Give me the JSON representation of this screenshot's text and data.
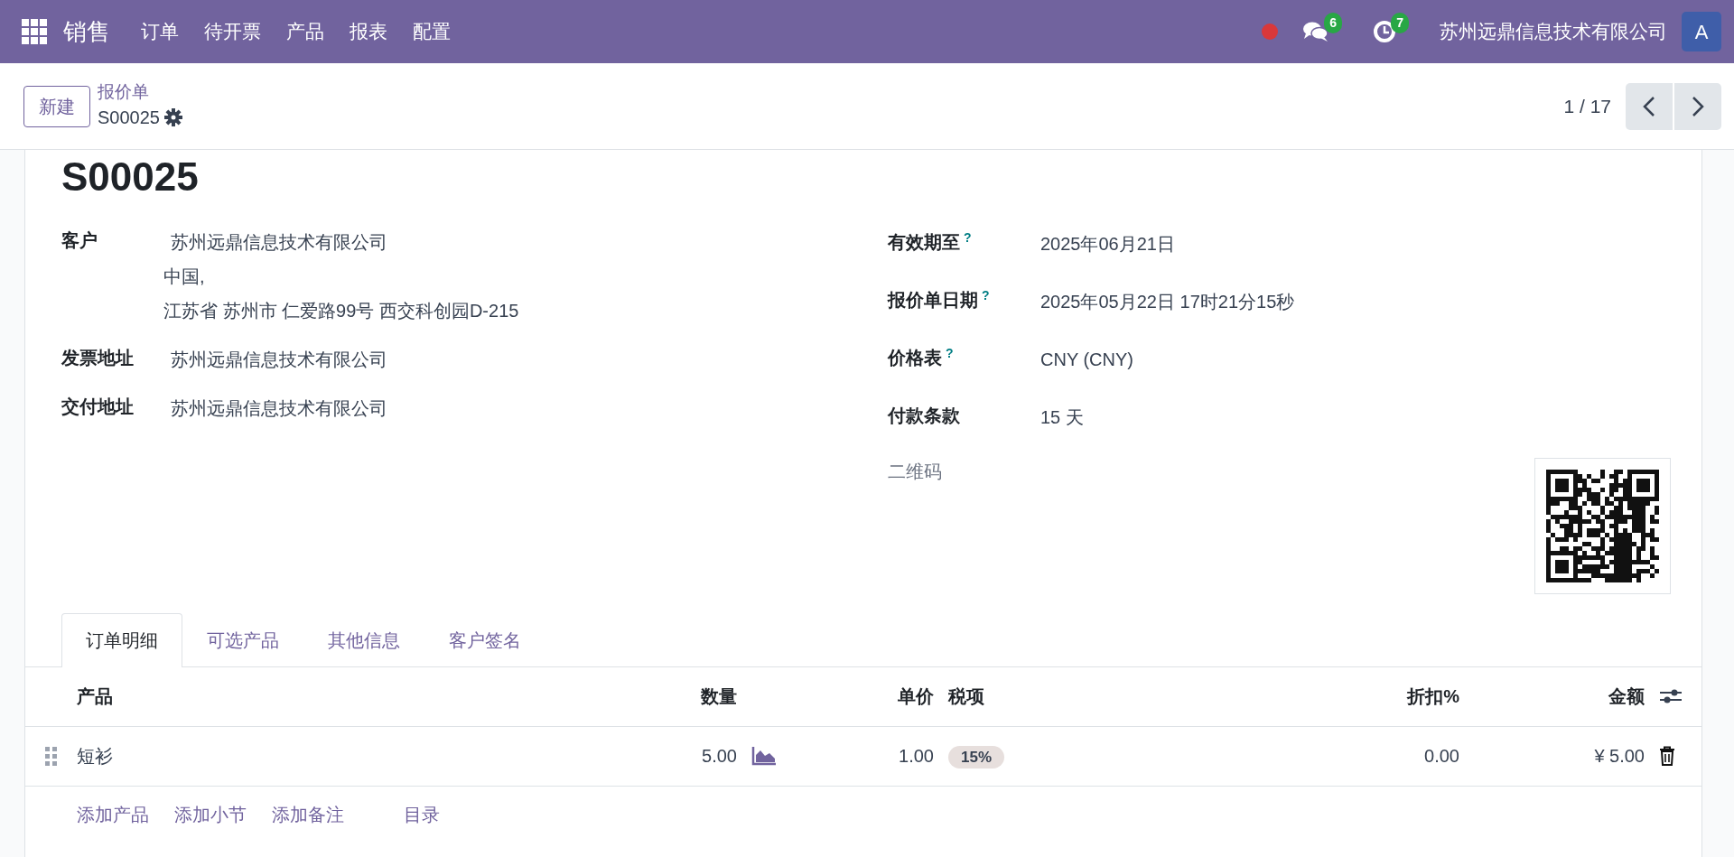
{
  "navbar": {
    "app_name": "销售",
    "menu": [
      "订单",
      "待开票",
      "产品",
      "报表",
      "配置"
    ],
    "chat_count": "6",
    "activity_count": "7",
    "company": "苏州远鼎信息技术有限公司",
    "avatar": "A"
  },
  "control_panel": {
    "new_button": "新建",
    "breadcrumb": "报价单",
    "record": "S00025",
    "pager": "1 / 17"
  },
  "form": {
    "title": "S00025",
    "left_fields": [
      {
        "label": "客户",
        "value": "苏州远鼎信息技术有限公司",
        "address_lines": [
          "中国,",
          "江苏省 苏州市 仁爱路99号 西交科创园D-215"
        ]
      },
      {
        "label": "发票地址",
        "value": "苏州远鼎信息技术有限公司"
      },
      {
        "label": "交付地址",
        "value": "苏州远鼎信息技术有限公司"
      }
    ],
    "right_fields": [
      {
        "label": "有效期至",
        "hint": "?",
        "value": "2025年06月21日"
      },
      {
        "label": "报价单日期",
        "hint": "?",
        "value": "2025年05月22日 17时21分15秒"
      },
      {
        "label": "价格表",
        "hint": "?",
        "value": "CNY (CNY)"
      },
      {
        "label": "付款条款",
        "value": "15 天"
      }
    ],
    "qr_label": "二维码"
  },
  "tabs": [
    {
      "label": "订单明细",
      "selected": true
    },
    {
      "label": "可选产品",
      "selected": false
    },
    {
      "label": "其他信息",
      "selected": false
    },
    {
      "label": "客户签名",
      "selected": false
    }
  ],
  "table": {
    "columns": [
      "产品",
      "数量",
      "单价",
      "税项",
      "折扣%",
      "金额"
    ],
    "rows": [
      {
        "product": "短衫",
        "quantity": "5.00",
        "unit_price": "1.00",
        "tax": "15%",
        "discount": "0.00",
        "amount": "¥ 5.00"
      }
    ],
    "actions": [
      "添加产品",
      "添加小节",
      "添加备注",
      "目录"
    ]
  }
}
